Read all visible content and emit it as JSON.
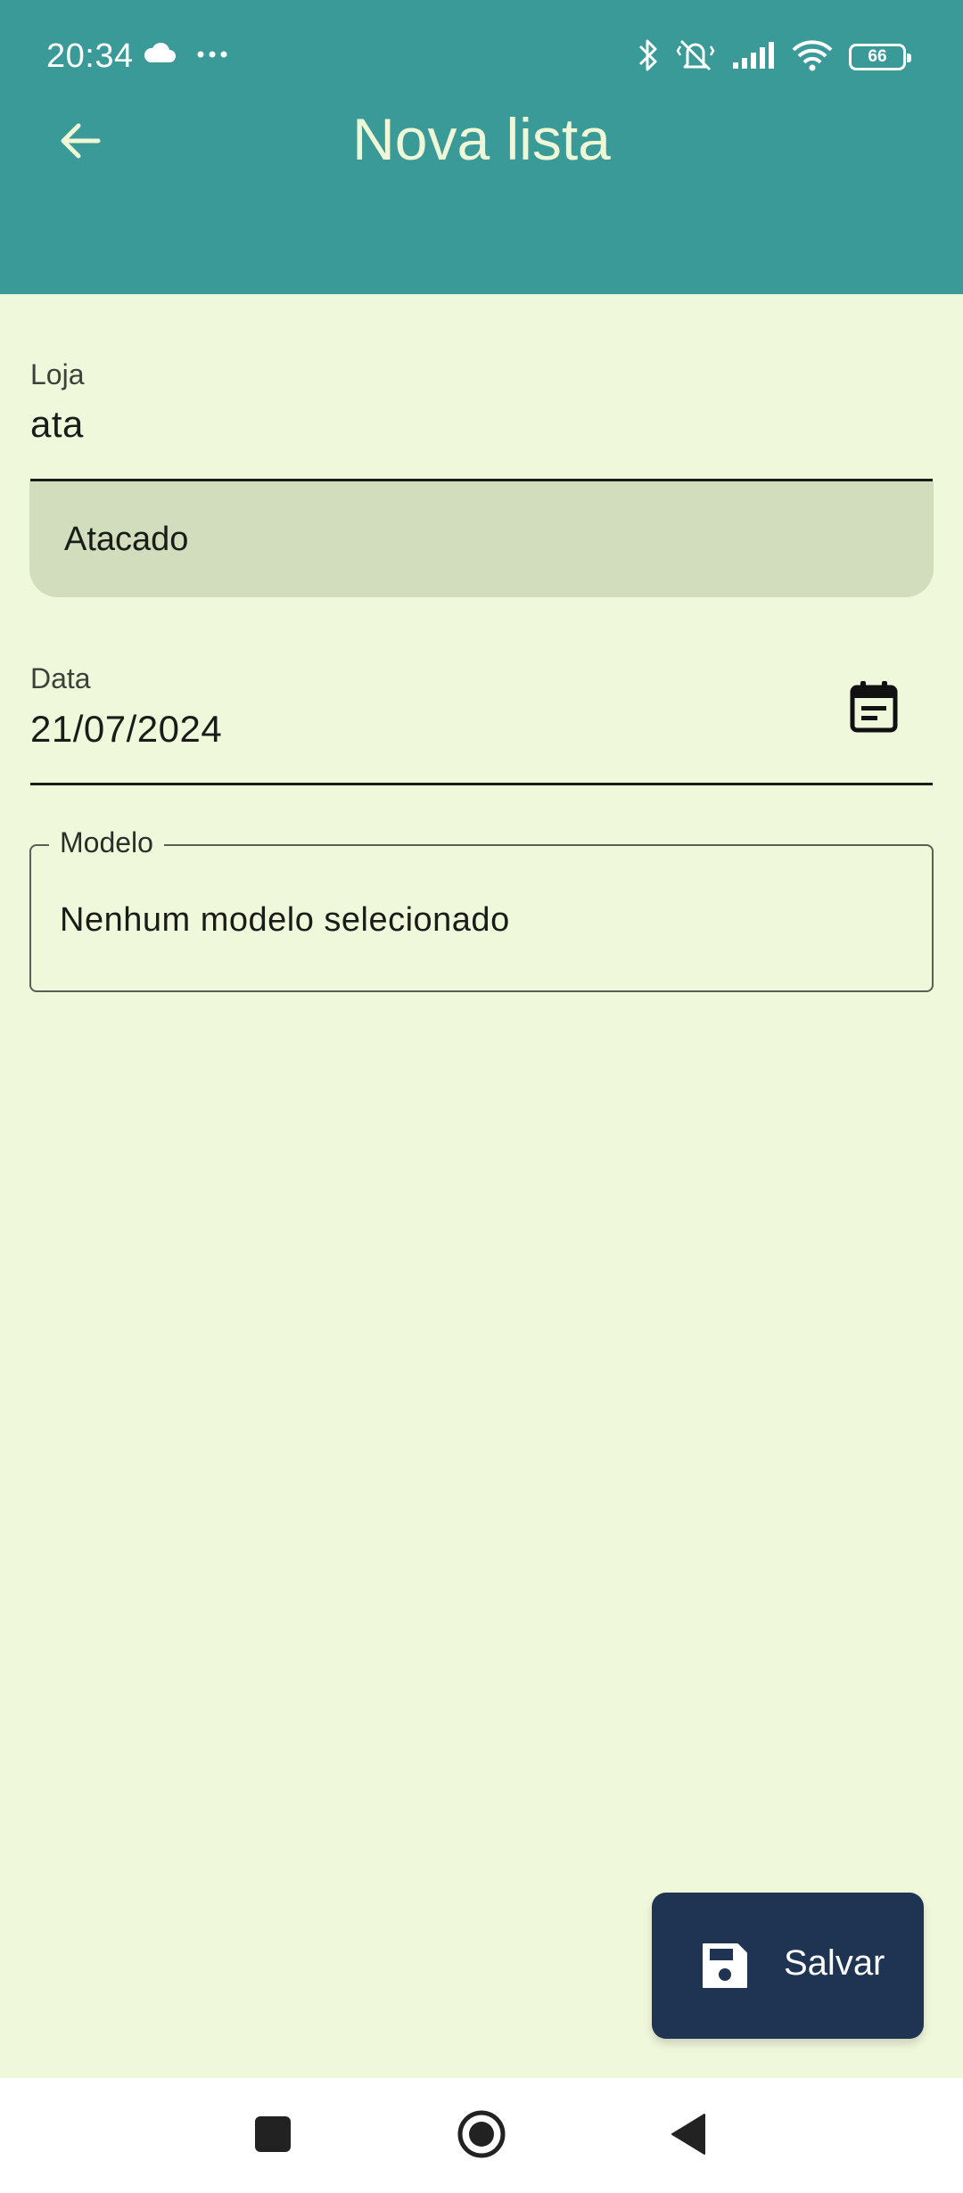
{
  "status_bar": {
    "time": "20:34",
    "battery": "66",
    "icons": [
      "cloud-icon",
      "more-dots-icon",
      "bluetooth-icon",
      "vibrate-off-icon",
      "signal-icon",
      "wifi-icon",
      "battery-icon"
    ]
  },
  "header": {
    "title": "Nova lista",
    "back_icon": "arrow-left-icon",
    "background": "#3a9a98"
  },
  "form": {
    "store": {
      "label": "Loja",
      "value": "ata",
      "suggestions": [
        "Atacado"
      ]
    },
    "date": {
      "label": "Data",
      "value": "21/07/2024",
      "icon": "calendar-icon"
    },
    "model": {
      "label": "Modelo",
      "value": "Nenhum modelo selecionado"
    }
  },
  "fab": {
    "label": "Salvar",
    "icon": "save-icon",
    "background": "#1f3352"
  },
  "nav_bar": {
    "icons": [
      "recents-icon",
      "home-icon",
      "back-icon"
    ]
  },
  "colors": {
    "page_background": "#f0f8dc",
    "suggestion_background": "#d2ddbe"
  }
}
